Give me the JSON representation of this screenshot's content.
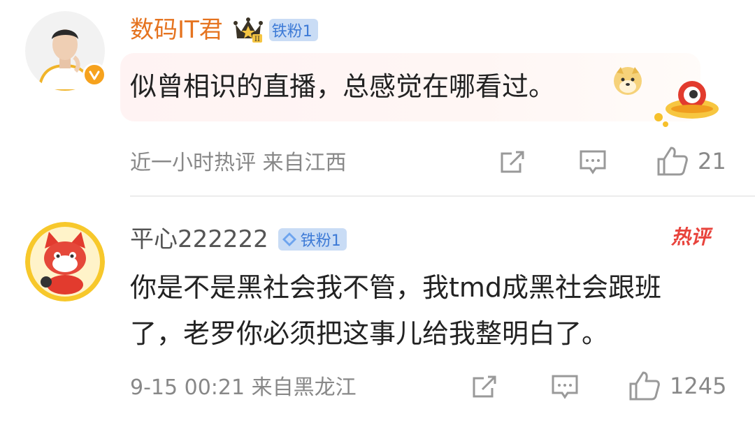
{
  "comments": [
    {
      "username": "数码IT君",
      "fan_badge": "铁粉1",
      "crown_level": "II",
      "text": "似曾相识的直播，总感觉在哪看过。",
      "meta": "近一小时热评  来自江西",
      "likes": "21",
      "verified": true
    },
    {
      "username": "平心222222",
      "fan_badge": "铁粉1",
      "hot_tag": "热评",
      "text_line1": "你是不是黑社会我不管，我tmd成黑社会跟班",
      "text_line2": "了，老罗你必须把这事儿给我整明白了。",
      "meta": "9-15 00:21  来自黑龙江",
      "likes": "1245"
    }
  ],
  "colors": {
    "username_highlight": "#e5731f",
    "badge_bg": "#c9dcf5",
    "badge_text": "#3d7ad6",
    "hot_tag": "#e8433c",
    "meta_text": "#888888"
  }
}
